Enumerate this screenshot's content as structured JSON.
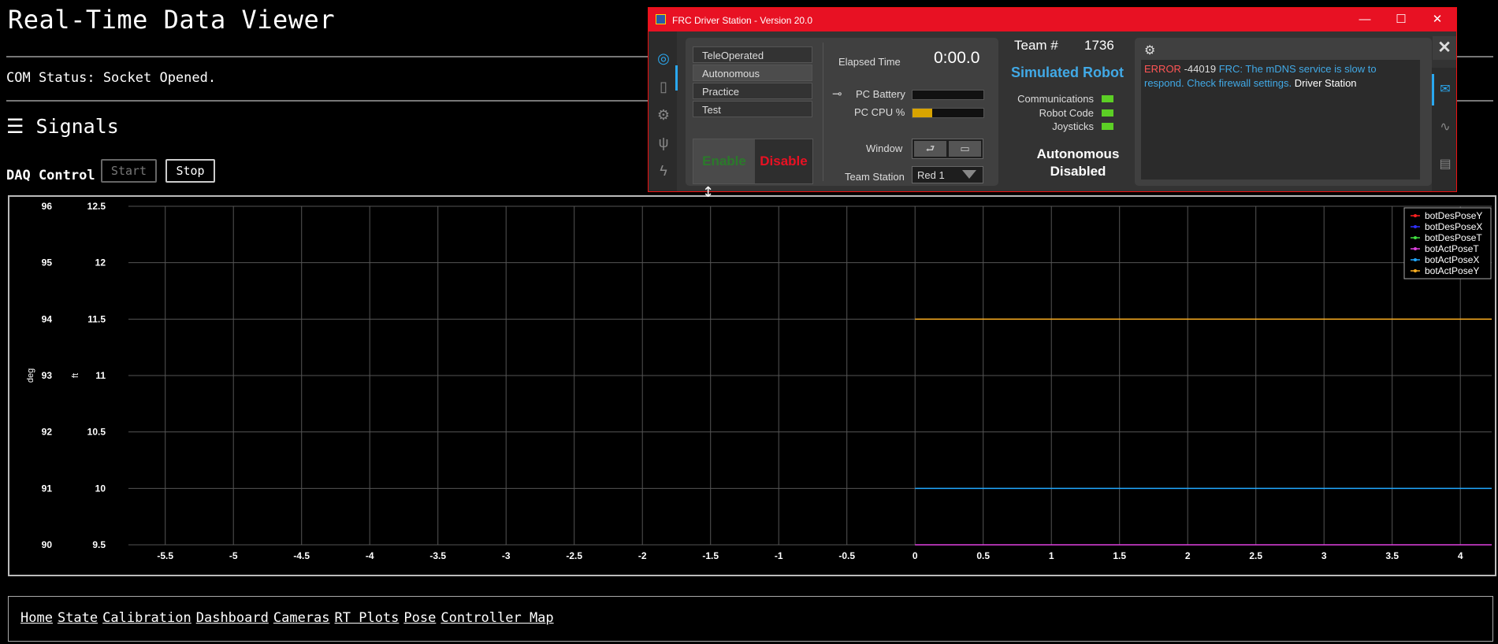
{
  "page": {
    "title": "Real-Time Data Viewer",
    "com_status": "COM Status: Socket Opened.",
    "signals_header": "☰ Signals",
    "daq_label": "DAQ Control",
    "start_label": "Start",
    "stop_label": "Stop",
    "nav_links": [
      "Home",
      "State",
      "Calibration",
      "Dashboard",
      "Cameras",
      "RT Plots",
      "Pose",
      "Controller Map"
    ]
  },
  "chart_data": {
    "type": "line",
    "x_ticks": [
      -5.5,
      -5,
      -4.5,
      -4,
      -3.5,
      -3,
      -2.5,
      -2,
      -1.5,
      -1,
      -0.5,
      0,
      0.5,
      1,
      1.5,
      2,
      2.5,
      3,
      3.5,
      4
    ],
    "xlim": [
      -5.77,
      4.23
    ],
    "y_axes": [
      {
        "label": "deg",
        "ticks": [
          90,
          91,
          92,
          93,
          94,
          95,
          96
        ],
        "ylim": [
          90,
          96
        ]
      },
      {
        "label": "ft",
        "ticks": [
          9.5,
          10,
          10.5,
          11,
          11.5,
          12,
          12.5
        ],
        "ylim": [
          9.5,
          12.5
        ]
      }
    ],
    "grid": true,
    "legend_placement": "top-right",
    "series": [
      {
        "name": "botDesPoseY",
        "color": "#ff2020",
        "axis": 1,
        "x": [],
        "y": []
      },
      {
        "name": "botDesPoseX",
        "color": "#3030ff",
        "axis": 1,
        "x": [],
        "y": []
      },
      {
        "name": "botDesPoseT",
        "color": "#40e040",
        "axis": 0,
        "x": [],
        "y": []
      },
      {
        "name": "botActPoseT",
        "color": "#e040e0",
        "axis": 0,
        "x": [
          0,
          4.23
        ],
        "y": [
          90,
          90
        ]
      },
      {
        "name": "botActPoseX",
        "color": "#20a8ff",
        "axis": 1,
        "x": [
          0,
          4.23
        ],
        "y": [
          10,
          10
        ]
      },
      {
        "name": "botActPoseY",
        "color": "#ffb020",
        "axis": 1,
        "x": [
          0,
          4.23
        ],
        "y": [
          11.5,
          11.5
        ]
      }
    ]
  },
  "ds": {
    "title": "FRC Driver Station - Version 20.0",
    "win_minimize": "—",
    "win_maximize": "☐",
    "win_close": "✕",
    "modes": [
      "TeleOperated",
      "Autonomous",
      "Practice",
      "Test"
    ],
    "selected_mode": "Autonomous",
    "enable_label": "Enable",
    "disable_label": "Disable",
    "elapsed_label": "Elapsed Time",
    "elapsed_value": "0:00.0",
    "pc_battery_label": "PC Battery",
    "pc_cpu_label": "PC CPU %",
    "pc_cpu_fraction": 0.28,
    "window_label": "Window",
    "team_station_label": "Team Station",
    "team_station_value": "Red 1",
    "team_label": "Team #",
    "team_number": "1736",
    "robot_name": "Simulated Robot",
    "status_communications": "Communications",
    "status_robot_code": "Robot Code",
    "status_joysticks": "Joysticks",
    "robot_state_line1": "Autonomous",
    "robot_state_line2": "Disabled",
    "message_error": "ERROR",
    "message_code": "-44019",
    "message_text": "FRC:  The mDNS service is slow to respond. Check firewall settings.",
    "message_source": "Driver Station",
    "colors": {
      "titlebar": "#e81123",
      "accent": "#2aa8f0",
      "error": "#ff5555",
      "message": "#41a9e6",
      "led": "#5ccf25"
    }
  }
}
